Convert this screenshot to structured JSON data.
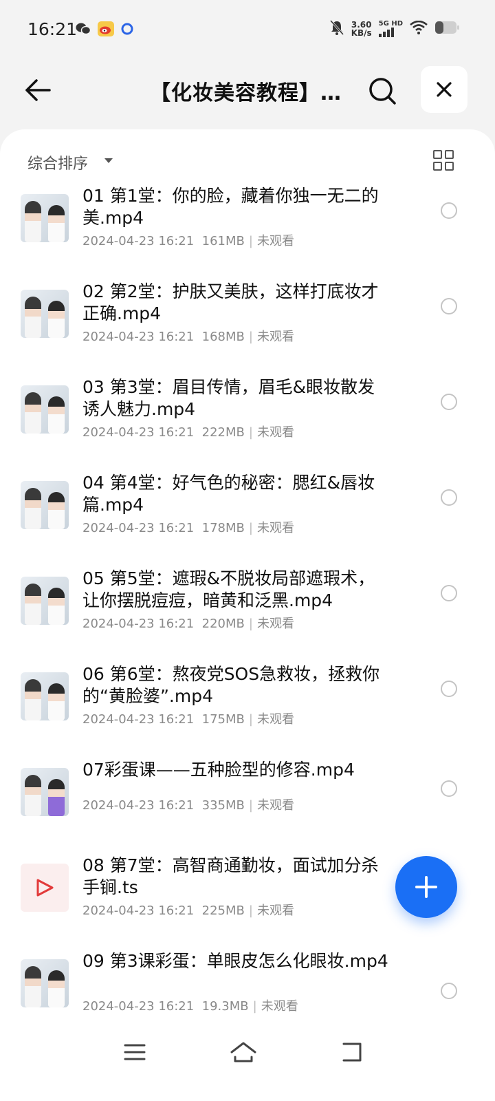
{
  "status_bar": {
    "time": "16:21",
    "speed_value": "3.60",
    "speed_unit": "KB/s",
    "network": "5G HD",
    "left_icons": [
      "wechat-icon",
      "weibo-icon",
      "app-dot-icon"
    ],
    "right_icons": [
      "mute-bell-icon",
      "signal-icon",
      "wifi-icon",
      "battery-icon"
    ]
  },
  "header": {
    "title": "【化妆美容教程】…",
    "icons": [
      "back-arrow-icon",
      "search-icon",
      "close-icon"
    ]
  },
  "toolbar": {
    "sort_label": "综合排序",
    "icons": [
      "caret-down-icon",
      "grid-view-icon"
    ]
  },
  "files": [
    {
      "title": "01 第1堂：你的脸，藏着你独一无二的美.mp4",
      "date": "2024-04-23 16:21",
      "size": "161MB",
      "status": "未观看",
      "thumb": "video-thumb"
    },
    {
      "title": "02 第2堂：护肤又美肤，这样打底妆才正确.mp4",
      "date": "2024-04-23 16:21",
      "size": "168MB",
      "status": "未观看",
      "thumb": "video-thumb"
    },
    {
      "title": "03 第3堂：眉目传情，眉毛&眼妆散发诱人魅力.mp4",
      "date": "2024-04-23 16:21",
      "size": "222MB",
      "status": "未观看",
      "thumb": "video-thumb"
    },
    {
      "title": "04 第4堂：好气色的秘密：腮红&唇妆篇.mp4",
      "date": "2024-04-23 16:21",
      "size": "178MB",
      "status": "未观看",
      "thumb": "video-thumb"
    },
    {
      "title": "05 第5堂：遮瑕&不脱妆局部遮瑕术，让你摆脱痘痘，暗黄和泛黑.mp4",
      "date": "2024-04-23 16:21",
      "size": "220MB",
      "status": "未观看",
      "thumb": "video-thumb"
    },
    {
      "title": "06 第6堂：熬夜党SOS急救妆，拯救你的“黄脸婆”.mp4",
      "date": "2024-04-23 16:21",
      "size": "175MB",
      "status": "未观看",
      "thumb": "video-thumb"
    },
    {
      "title": "07彩蛋课——五种脸型的修容.mp4",
      "date": "2024-04-23 16:21",
      "size": "335MB",
      "status": "未观看",
      "thumb": "video-thumb-purple"
    },
    {
      "title": "08 第7堂：高智商通勤妆，面试加分杀手锏.ts",
      "date": "2024-04-23 16:21",
      "size": "225MB",
      "status": "未观看",
      "thumb": "play-icon"
    },
    {
      "title": "09 第3课彩蛋：单眼皮怎么化眼妆.mp4",
      "date": "2024-04-23 16:21",
      "size": "19.3MB",
      "status": "未观看",
      "thumb": "video-thumb"
    }
  ],
  "fab": {
    "icon": "plus-icon"
  },
  "nav_bar": {
    "icons": [
      "menu-icon",
      "home-icon",
      "back-nav-icon"
    ]
  },
  "colors": {
    "accent": "#1a6ff5",
    "background": "#f3f3f3"
  }
}
